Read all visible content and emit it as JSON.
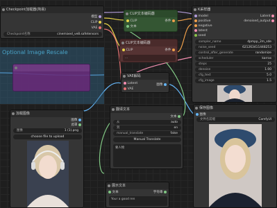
{
  "colors": {
    "clip": "#e8d34a",
    "conditioning": "#f0a04b",
    "model": "#b39ddb",
    "vae": "#e57373",
    "latent": "#f48fb1",
    "image": "#64b5f6",
    "string": "#81c784",
    "group_bg": "#336688",
    "clip_node": "#345633",
    "neg_node": "#553333",
    "bypassed": "#6a2a7a"
  },
  "checkpoint": {
    "title": "Checkpoint加载器(简易)",
    "outputs": [
      "模型",
      "CLIP",
      "VAE"
    ],
    "widget_label": "Checkpoint名称",
    "widget_value": "cinemixed_ve8.safetensors"
  },
  "clip_pos": {
    "title": "CLIP文本编码器",
    "input": "CLIP",
    "output": "条件",
    "text_input": "文本"
  },
  "clip_neg": {
    "title": "CLIP文本编码器",
    "input": "CLIP",
    "output": "条件",
    "text": "..."
  },
  "group": {
    "title": "Optional Image Rescale"
  },
  "ksampler": {
    "title": "K采样器",
    "inputs": [
      "model",
      "positive",
      "negative",
      "latent"
    ],
    "input_extra": "seed",
    "output": "Latent",
    "rows": [
      {
        "label": "sampler_name",
        "value": "dpmpp_2m_sde"
      },
      {
        "label": "noise_seed",
        "value": "621263411448253"
      },
      {
        "label": "control_after_generate",
        "value": "randomize"
      },
      {
        "label": "scheduler",
        "value": "karras"
      },
      {
        "label": "steps",
        "value": "25"
      },
      {
        "label": "denoise",
        "value": "1.00"
      },
      {
        "label": "cfg_text",
        "value": "5.0"
      },
      {
        "label": "cfg_image",
        "value": "1.5"
      }
    ],
    "sampler_output": "denoised_output"
  },
  "vae_decode": {
    "title": "VAE解码",
    "inputs": [
      "Latent",
      "VAE"
    ],
    "output": "图像"
  },
  "load_image": {
    "title": "加载图像",
    "outputs": [
      "图像",
      "遮罩"
    ],
    "widget_label": "图像",
    "widget_value": "1 (1).png",
    "button": "choose file to upload"
  },
  "translate": {
    "title": "翻译文本",
    "inputs": [
      "文本"
    ],
    "output": "文本",
    "rows": [
      {
        "label": "从",
        "value": "auto"
      },
      {
        "label": "到",
        "value": "en"
      },
      {
        "label": "manual_translate",
        "value": "false"
      }
    ],
    "button": "Manual Translate",
    "textarea": "要人物"
  },
  "show_text": {
    "title": "展示文本",
    "input": "文本",
    "output": "字符串",
    "textarea": "Your a good ren"
  },
  "save_image": {
    "title": "保存图像",
    "input": "图像",
    "widget_label": "文件名前缀",
    "widget_value": "ComfyUI"
  }
}
